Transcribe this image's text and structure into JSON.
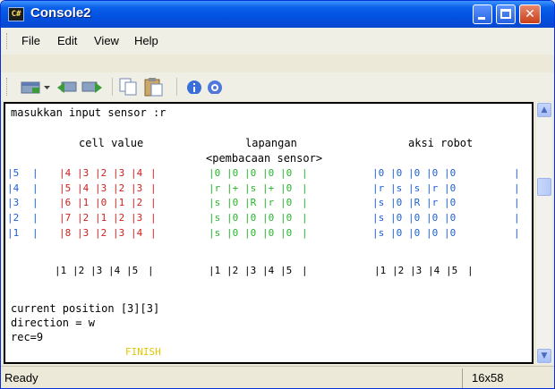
{
  "window": {
    "title": "Console2",
    "icon_text": "C#"
  },
  "menu": [
    "File",
    "Edit",
    "View",
    "Help"
  ],
  "toolbar": [
    "new-tab-icon",
    "dropdown-arrow-icon",
    "back-icon",
    "forward-icon",
    "copy-icon",
    "paste-icon",
    "info-icon",
    "help-icon"
  ],
  "console": {
    "prompt": "masukkan input sensor :r",
    "headers": {
      "cell_value": "cell value",
      "lapangan": "lapangan",
      "sub": "<pembacaan sensor>",
      "aksi": "aksi robot"
    },
    "row_labels": [
      "5",
      "4",
      "3",
      "2",
      "1"
    ],
    "cell_values": [
      [
        "4",
        "3",
        "2",
        "3",
        "4"
      ],
      [
        "5",
        "4",
        "3",
        "2",
        "3"
      ],
      [
        "6",
        "1",
        "0",
        "1",
        "2"
      ],
      [
        "7",
        "2",
        "1",
        "2",
        "3"
      ],
      [
        "8",
        "3",
        "2",
        "3",
        "4"
      ]
    ],
    "lapangan": [
      [
        "0",
        "0",
        "0",
        "0",
        "0"
      ],
      [
        "r",
        "+",
        "s",
        "+",
        "0"
      ],
      [
        "s",
        "0",
        "R",
        "r",
        "0"
      ],
      [
        "s",
        "0",
        "0",
        "0",
        "0"
      ],
      [
        "s",
        "0",
        "0",
        "0",
        "0"
      ]
    ],
    "aksi": [
      [
        "0",
        "0",
        "0",
        "0",
        "0"
      ],
      [
        "r",
        "s",
        "s",
        "r",
        "0"
      ],
      [
        "s",
        "0",
        "R",
        "r",
        "0"
      ],
      [
        "s",
        "0",
        "0",
        "0",
        "0"
      ],
      [
        "s",
        "0",
        "0",
        "0",
        "0"
      ]
    ],
    "col_numbers": [
      "1",
      "2",
      "3",
      "4",
      "5"
    ],
    "position": "current position [3][3]",
    "direction": "direction = w",
    "rec": "rec=9",
    "finish": "FINISH"
  },
  "status": {
    "text": "Ready",
    "dims": "16x58"
  },
  "colors": {
    "red": "#d21f1f",
    "green": "#26b52a",
    "blue": "#1d5fd6",
    "finish": "#e3c600"
  }
}
